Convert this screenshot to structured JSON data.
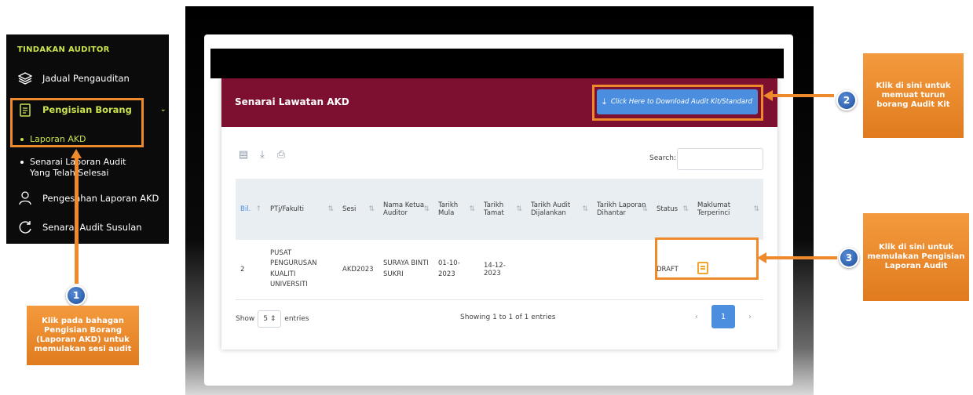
{
  "sidebar": {
    "title": "TINDAKAN AUDITOR",
    "items": [
      {
        "label": "Jadual Pengauditan",
        "icon": "layers-icon"
      },
      {
        "label": "Pengisian Borang",
        "icon": "document-icon"
      },
      {
        "label": "Pengesahan Laporan AKD",
        "icon": "user-icon"
      },
      {
        "label": "Senarai Audit Susulan",
        "icon": "refresh-icon"
      }
    ],
    "sub": {
      "active": "Laporan AKD",
      "other_line1": "Senarai Laporan Audit",
      "other_line2": "Yang Telah Selesai"
    }
  },
  "panel": {
    "title": "Senarai Lawatan AKD",
    "download_label": "Click Here to Download Audit Kit/Standard",
    "search_label": "Search:",
    "search_value": ""
  },
  "table": {
    "headers": [
      "Bil.",
      "PTj/Fakulti",
      "Sesi",
      "Nama Ketua Auditor",
      "Tarikh Mula",
      "Tarikh Tamat",
      "Tarikh Audit Dijalankan",
      "Tarikh Laporan Dihantar",
      "Status",
      "Maklumat Terperinci"
    ],
    "row": {
      "bil": "2",
      "ptj": "PUSAT PENGURUSAN KUALITI UNIVERSITI",
      "sesi": "AKD2023",
      "ketua": "SURAYA BINTI SUKRI",
      "mula": "01-10-2023",
      "tamat": "14-12-2023",
      "dijalankan": "",
      "dihantar": "",
      "status": "DRAFT"
    }
  },
  "footer": {
    "show": "Show",
    "entries_value": "5",
    "entries": "entries",
    "info": "Showing 1 to 1 of 1 entries",
    "page": "1"
  },
  "callouts": {
    "c1": {
      "num": "1",
      "text": "Klik pada bahagan Pengisian Borang (Laporan AKD) untuk memulakan sesi audit"
    },
    "c2": {
      "num": "2",
      "text": "Klik di sini untuk memuat turun borang Audit Kit"
    },
    "c3": {
      "num": "3",
      "text": "Klik di sini untuk memulakan Pengisian Laporan Audit"
    }
  },
  "colors": {
    "accent": "#ef8a2c",
    "header": "#7d0f30",
    "button": "#4b8ee0"
  }
}
